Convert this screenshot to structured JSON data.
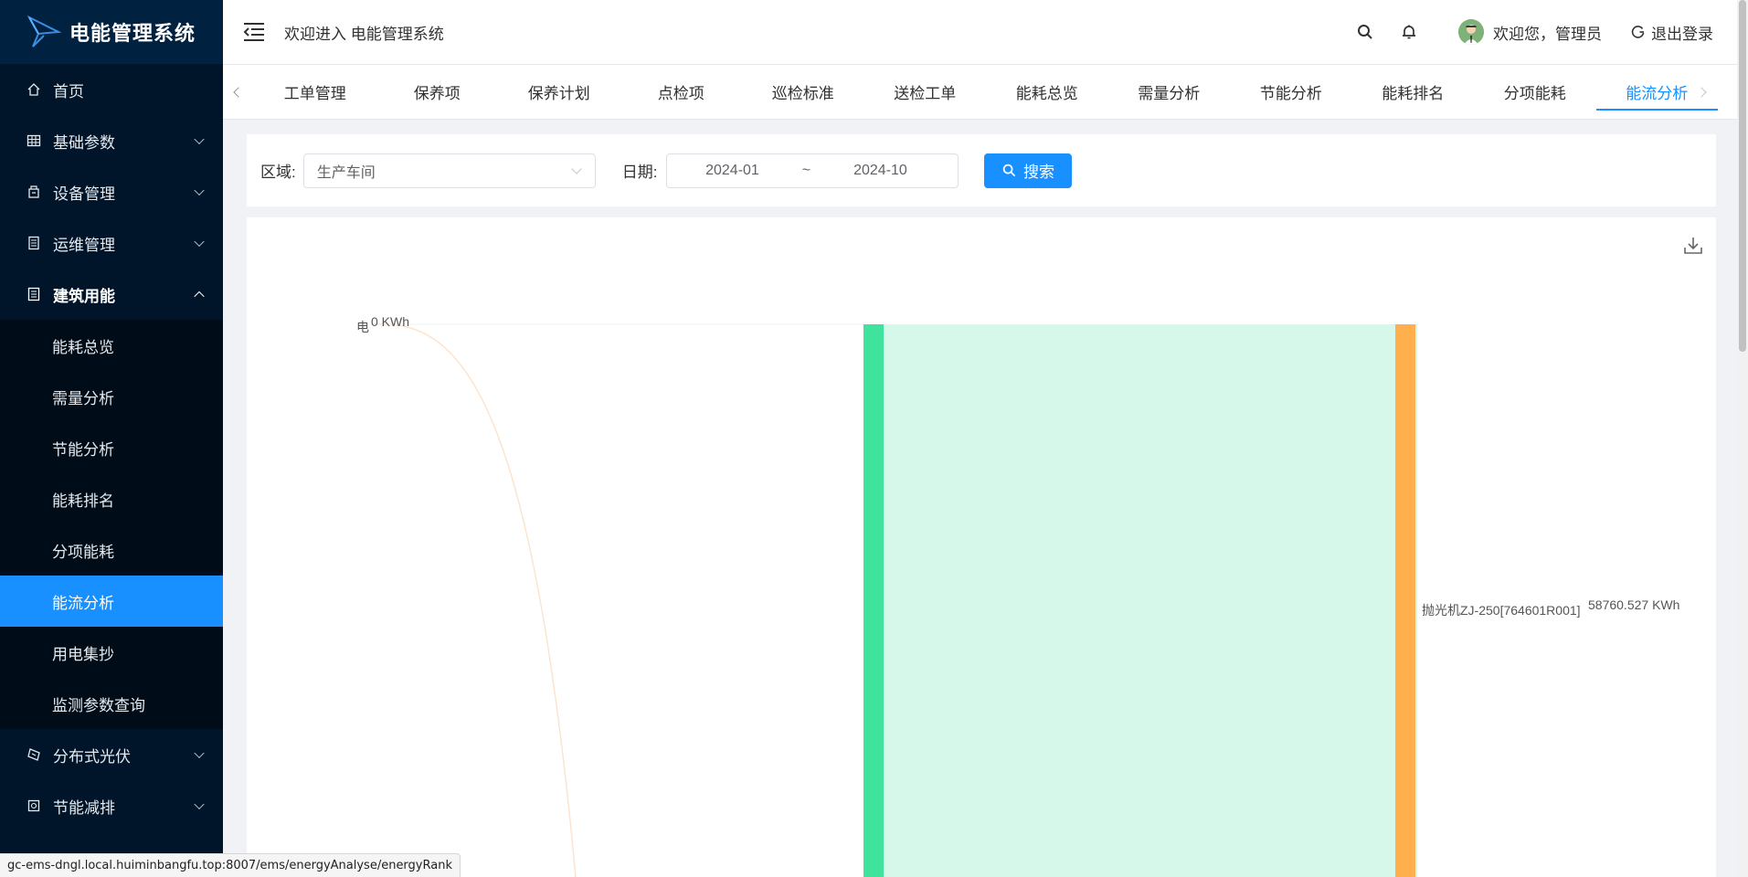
{
  "app": {
    "title": "电能管理系统"
  },
  "sidebar": {
    "items": [
      {
        "label": "首页",
        "icon": "home-icon"
      },
      {
        "label": "基础参数",
        "icon": "grid-icon"
      },
      {
        "label": "设备管理",
        "icon": "device-icon"
      },
      {
        "label": "运维管理",
        "icon": "list-icon"
      },
      {
        "label": "建筑用能",
        "icon": "building-icon"
      },
      {
        "label": "分布式光伏",
        "icon": "solar-icon"
      },
      {
        "label": "节能减排",
        "icon": "leaf-icon"
      }
    ],
    "subitems": [
      {
        "label": "能耗总览"
      },
      {
        "label": "需量分析"
      },
      {
        "label": "节能分析"
      },
      {
        "label": "能耗排名"
      },
      {
        "label": "分项能耗"
      },
      {
        "label": "能流分析"
      },
      {
        "label": "用电集抄"
      },
      {
        "label": "监测参数查询"
      }
    ]
  },
  "header": {
    "welcome": "欢迎进入 电能管理系统",
    "user": "欢迎您，管理员",
    "logout": "退出登录"
  },
  "tabs": [
    "工单管理",
    "保养项",
    "保养计划",
    "点检项",
    "巡检标准",
    "送检工单",
    "能耗总览",
    "需量分析",
    "节能分析",
    "能耗排名",
    "分项能耗",
    "能流分析"
  ],
  "active_tab": "能流分析",
  "filter": {
    "area_label": "区域:",
    "area_value": "生产车间",
    "date_label": "日期:",
    "date_start": "2024-01",
    "date_sep": "~",
    "date_end": "2024-10",
    "search_label": "搜索"
  },
  "chart_data": {
    "type": "sankey",
    "nodes": [
      {
        "name": "电",
        "value": "0 KWh"
      },
      {
        "name": "抛光机ZJ-250[764601R001]",
        "value": "58760.527 KWh"
      }
    ],
    "colors": {
      "source": "#ffa940",
      "middle": "#3fe39b",
      "target": "#ffb04d",
      "flow": "#d6f8ea"
    }
  },
  "status_bar": {
    "url": "gc-ems-dngl.local.huiminbangfu.top:8007/ems/energyAnalyse/energyRank"
  }
}
